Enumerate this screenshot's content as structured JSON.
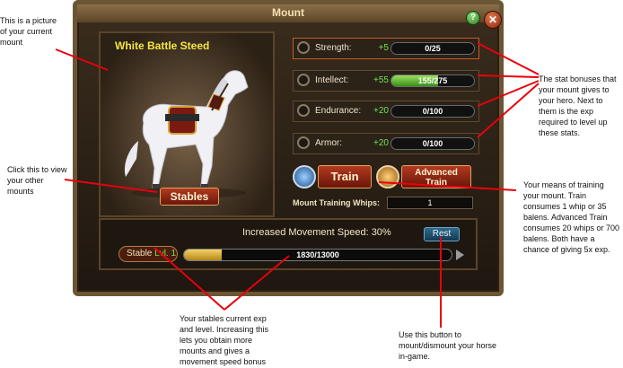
{
  "window": {
    "title": "Mount",
    "help": "?",
    "close": "✕",
    "mount_name": "White Battle Steed",
    "stables_label": "Stables",
    "stats": [
      {
        "label": "Strength:",
        "bonus": "+5",
        "value": "0/25",
        "fill": 0.0,
        "active": true
      },
      {
        "label": "Intellect:",
        "bonus": "+55",
        "value": "155/275",
        "fill": 0.5636,
        "active": false
      },
      {
        "label": "Endurance:",
        "bonus": "+20",
        "value": "0/100",
        "fill": 0.0,
        "active": false
      },
      {
        "label": "Armor:",
        "bonus": "+20",
        "value": "0/100",
        "fill": 0.0,
        "active": false
      }
    ],
    "train_label": "Train",
    "advanced_train_line1": "Advanced",
    "advanced_train_line2": "Train",
    "whips_label": "Mount Training Whips:",
    "whips_value": "1",
    "speed_text": "Increased Movement Speed:  30%",
    "rest_label": "Rest",
    "stable_label": "Stable",
    "stable_level": "Lvl. 1",
    "stable_exp": "1830/13000",
    "stable_fill": 0.1408
  },
  "annotations": {
    "picture": "This is a picture of your current mount",
    "stables": "Click this to view your other mounts",
    "stats": "The stat bonuses that your mount gives to your hero. Next to them is the exp required to level up these stats.",
    "train": "Your means of training your mount. Train consumes 1 whip or 35 balens. Advanced Train consumes 20 whips or 700 balens. Both have a chance of giving 5x exp.",
    "stable": "Your stables current exp and level. Increasing this lets you obtain more mounts and gives a movement speed bonus",
    "rest": "Use this button to mount/dismount your horse in-game."
  },
  "colors": {
    "annotation_line": "#e8000c",
    "bonus_green": "#6fe24e",
    "mount_name": "#f4e641"
  }
}
